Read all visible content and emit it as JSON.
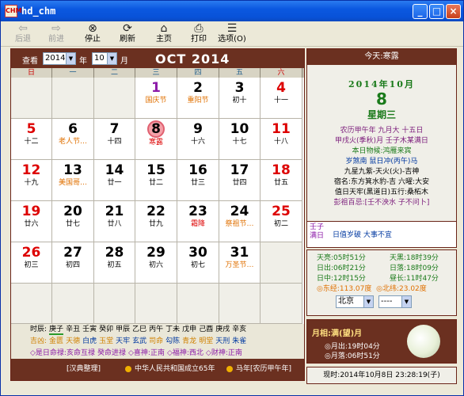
{
  "window": {
    "title": "hd_chm",
    "icon_text": "CHM"
  },
  "toolbar": [
    {
      "name": "back",
      "label": "后退",
      "icon": "back-arrow-icon",
      "disabled": true
    },
    {
      "name": "forward",
      "label": "前进",
      "icon": "forward-arrow-icon",
      "disabled": true
    },
    {
      "name": "stop",
      "label": "停止",
      "icon": "stop-icon",
      "disabled": false
    },
    {
      "name": "refresh",
      "label": "刷新",
      "icon": "refresh-icon",
      "disabled": false
    },
    {
      "name": "home",
      "label": "主页",
      "icon": "home-icon",
      "disabled": false
    },
    {
      "name": "print",
      "label": "打印",
      "icon": "print-icon",
      "disabled": false
    },
    {
      "name": "options",
      "label": "选项(O)",
      "icon": "options-icon",
      "disabled": false
    }
  ],
  "calendar": {
    "view_label": "查看",
    "year_value": "2014",
    "year_unit": "年",
    "month_value": "10",
    "month_unit": "月",
    "title": "OCT 2014",
    "weekdays": [
      "日",
      "一",
      "二",
      "三",
      "四",
      "五",
      "六"
    ],
    "weeks": [
      [
        null,
        null,
        null,
        {
          "d": "1",
          "s": "国庆节",
          "dc": "#8c1aa8",
          "sc": "#e07000"
        },
        {
          "d": "2",
          "s": "重阳节",
          "dc": "#000",
          "sc": "#e07000"
        },
        {
          "d": "3",
          "s": "初十",
          "dc": "#000",
          "sc": "#000"
        },
        {
          "d": "4",
          "s": "十一",
          "dc": "#d00",
          "sc": "#000"
        }
      ],
      [
        {
          "d": "5",
          "s": "十二",
          "dc": "#d00",
          "sc": "#000"
        },
        {
          "d": "6",
          "s": "老人节…",
          "dc": "#000",
          "sc": "#e07000"
        },
        {
          "d": "7",
          "s": "十四",
          "dc": "#000",
          "sc": "#000"
        },
        {
          "d": "8",
          "s": "寒露",
          "dc": "#000",
          "sc": "#d00",
          "today": true
        },
        {
          "d": "9",
          "s": "十六",
          "dc": "#000",
          "sc": "#000"
        },
        {
          "d": "10",
          "s": "十七",
          "dc": "#000",
          "sc": "#000"
        },
        {
          "d": "11",
          "s": "十八",
          "dc": "#d00",
          "sc": "#000"
        }
      ],
      [
        {
          "d": "12",
          "s": "十九",
          "dc": "#d00",
          "sc": "#000"
        },
        {
          "d": "13",
          "s": "美国哥…",
          "dc": "#000",
          "sc": "#e07000"
        },
        {
          "d": "14",
          "s": "廿一",
          "dc": "#000",
          "sc": "#000"
        },
        {
          "d": "15",
          "s": "廿二",
          "dc": "#000",
          "sc": "#000"
        },
        {
          "d": "16",
          "s": "廿三",
          "dc": "#000",
          "sc": "#000"
        },
        {
          "d": "17",
          "s": "廿四",
          "dc": "#000",
          "sc": "#000"
        },
        {
          "d": "18",
          "s": "廿五",
          "dc": "#d00",
          "sc": "#000"
        }
      ],
      [
        {
          "d": "19",
          "s": "廿六",
          "dc": "#d00",
          "sc": "#000"
        },
        {
          "d": "20",
          "s": "廿七",
          "dc": "#000",
          "sc": "#000"
        },
        {
          "d": "21",
          "s": "廿八",
          "dc": "#000",
          "sc": "#000"
        },
        {
          "d": "22",
          "s": "廿九",
          "dc": "#000",
          "sc": "#000"
        },
        {
          "d": "23",
          "s": "霜降",
          "dc": "#000",
          "sc": "#d00"
        },
        {
          "d": "24",
          "s": "祭祖节…",
          "dc": "#000",
          "sc": "#e07000"
        },
        {
          "d": "25",
          "s": "初二",
          "dc": "#d00",
          "sc": "#000"
        }
      ],
      [
        {
          "d": "26",
          "s": "初三",
          "dc": "#d00",
          "sc": "#000"
        },
        {
          "d": "27",
          "s": "初四",
          "dc": "#000",
          "sc": "#000"
        },
        {
          "d": "28",
          "s": "初五",
          "dc": "#000",
          "sc": "#000"
        },
        {
          "d": "29",
          "s": "初六",
          "dc": "#000",
          "sc": "#000"
        },
        {
          "d": "30",
          "s": "初七",
          "dc": "#000",
          "sc": "#000"
        },
        {
          "d": "31",
          "s": "万圣节…",
          "dc": "#000",
          "sc": "#e07000"
        },
        null
      ],
      [
        null,
        null,
        null,
        null,
        null,
        null,
        null
      ]
    ]
  },
  "hours": {
    "label": "时辰:",
    "items": [
      "庚子",
      "辛丑",
      "壬寅",
      "癸卯",
      "甲辰",
      "乙巳",
      "丙午",
      "丁未",
      "戊申",
      "己酉",
      "庚戌",
      "辛亥"
    ]
  },
  "luck": {
    "label": "吉凶:",
    "items": [
      {
        "t": "金匮",
        "c": "#d08000"
      },
      {
        "t": "天德",
        "c": "#d08000"
      },
      {
        "t": "白虎",
        "c": "#0038a0"
      },
      {
        "t": "玉堂",
        "c": "#d08000"
      },
      {
        "t": "天牢",
        "c": "#0038a0"
      },
      {
        "t": "玄武",
        "c": "#0038a0"
      },
      {
        "t": "司命",
        "c": "#d08000"
      },
      {
        "t": "勾陈",
        "c": "#0038a0"
      },
      {
        "t": "青龙",
        "c": "#d08000"
      },
      {
        "t": "明堂",
        "c": "#d08000"
      },
      {
        "t": "天刑",
        "c": "#0038a0"
      },
      {
        "t": "朱雀",
        "c": "#0038a0"
      }
    ]
  },
  "directions": [
    "◇是日命禄:亥命互禄",
    "癸命进禄",
    "◇喜神:正南",
    "◇福神:西北",
    "◇财神:正南"
  ],
  "status_left": {
    "credit": "[汉典整理]",
    "country": "中华人民共和国成立65年",
    "year": "马年[农历甲午年]"
  },
  "right": {
    "today_bar": "今天:寒露",
    "date_line": "2014年10月",
    "day": "8",
    "weekday": "星期三",
    "lunar1": "农历甲午年 九月大 十五日",
    "lunar2": "甲戌火(季秋)月 壬子木某满日",
    "phenology": "本日物候:鸿雁来宾",
    "sui": "岁煞南 鼠日冲(丙午)马",
    "star1": "九星九紫-天火(火)-吉神",
    "star2": "宿名:东方箕水豹-吉 六曜:大安",
    "star3": "值日天牢(黑道日)五行:桑柘木",
    "pengzu": "彭祖百忌:[壬不泱水 子不问卜]",
    "day_tag": "壬子\n满日",
    "yi": "日值岁破 大事不宜",
    "sun": [
      {
        "k": "天亮:05时51分",
        "v": "天黑:18时39分"
      },
      {
        "k": "日出:06时21分",
        "v": "日落:18时09分"
      },
      {
        "k": "日中:12时15分",
        "v": "昼长:11时47分"
      }
    ],
    "lon": "◎东经:113.07度",
    "lat": "◎北纬:23.02度",
    "city": "北京",
    "district": "----",
    "moon_title": "月相:满(望)月",
    "moon_rise": "◎月出:19时04分",
    "moon_set": "◎月落:06时51分",
    "now": "现时:2014年10月8日 23:28:19(子)"
  }
}
